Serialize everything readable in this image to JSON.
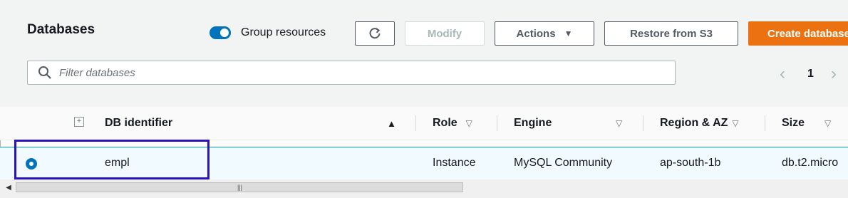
{
  "header": {
    "title": "Databases",
    "group_resources_label": "Group resources",
    "group_resources_on": true,
    "modify_label": "Modify",
    "actions_label": "Actions",
    "restore_label": "Restore from S3",
    "create_label": "Create database"
  },
  "search": {
    "placeholder": "Filter databases"
  },
  "pagination": {
    "current_page": "1"
  },
  "columns": {
    "db_identifier": "DB identifier",
    "role": "Role",
    "engine": "Engine",
    "region_az": "Region & AZ",
    "size": "Size"
  },
  "rows": [
    {
      "db_identifier": "empl",
      "role": "Instance",
      "engine": "MySQL Community",
      "region_az": "ap-south-1b",
      "size": "db.t2.micro",
      "selected": true
    }
  ],
  "colors": {
    "accent": "#0073bb",
    "primary_button": "#ec7211",
    "highlight_box": "#2a14b9"
  },
  "icons": [
    "refresh-icon",
    "caret-down-icon",
    "search-icon",
    "chevron-left-icon",
    "chevron-right-icon",
    "expand-all-icon",
    "sort-icon"
  ]
}
